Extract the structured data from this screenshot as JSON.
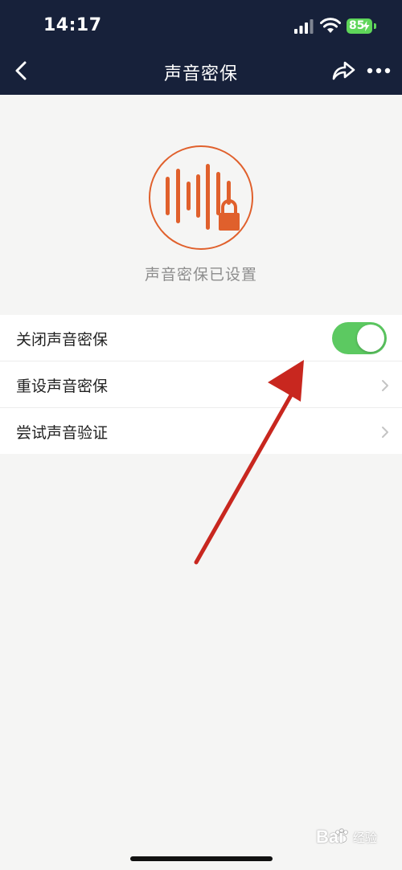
{
  "status_bar": {
    "time": "14:17",
    "battery": "85"
  },
  "nav": {
    "title": "声音密保"
  },
  "hero": {
    "caption": "声音密保已设置"
  },
  "settings": [
    {
      "label": "关闭声音密保",
      "control": "toggle",
      "on": true
    },
    {
      "label": "重设声音密保",
      "control": "chevron"
    },
    {
      "label": "尝试声音验证",
      "control": "chevron"
    }
  ],
  "watermark": {
    "brand": "Bai",
    "suffix": "经验"
  },
  "colors": {
    "header_bg": "#17213a",
    "accent_orange": "#e0602c",
    "toggle_on": "#5cc961",
    "battery": "#5fd65a",
    "arrow_red": "#c8271f",
    "background": "#f5f5f4"
  },
  "icons": {
    "back": "chevron-left-icon",
    "share": "share-arrow-icon",
    "more": "more-dots-icon",
    "hero": "voice-lock-icon",
    "row_arrow": "chevron-right-icon"
  }
}
